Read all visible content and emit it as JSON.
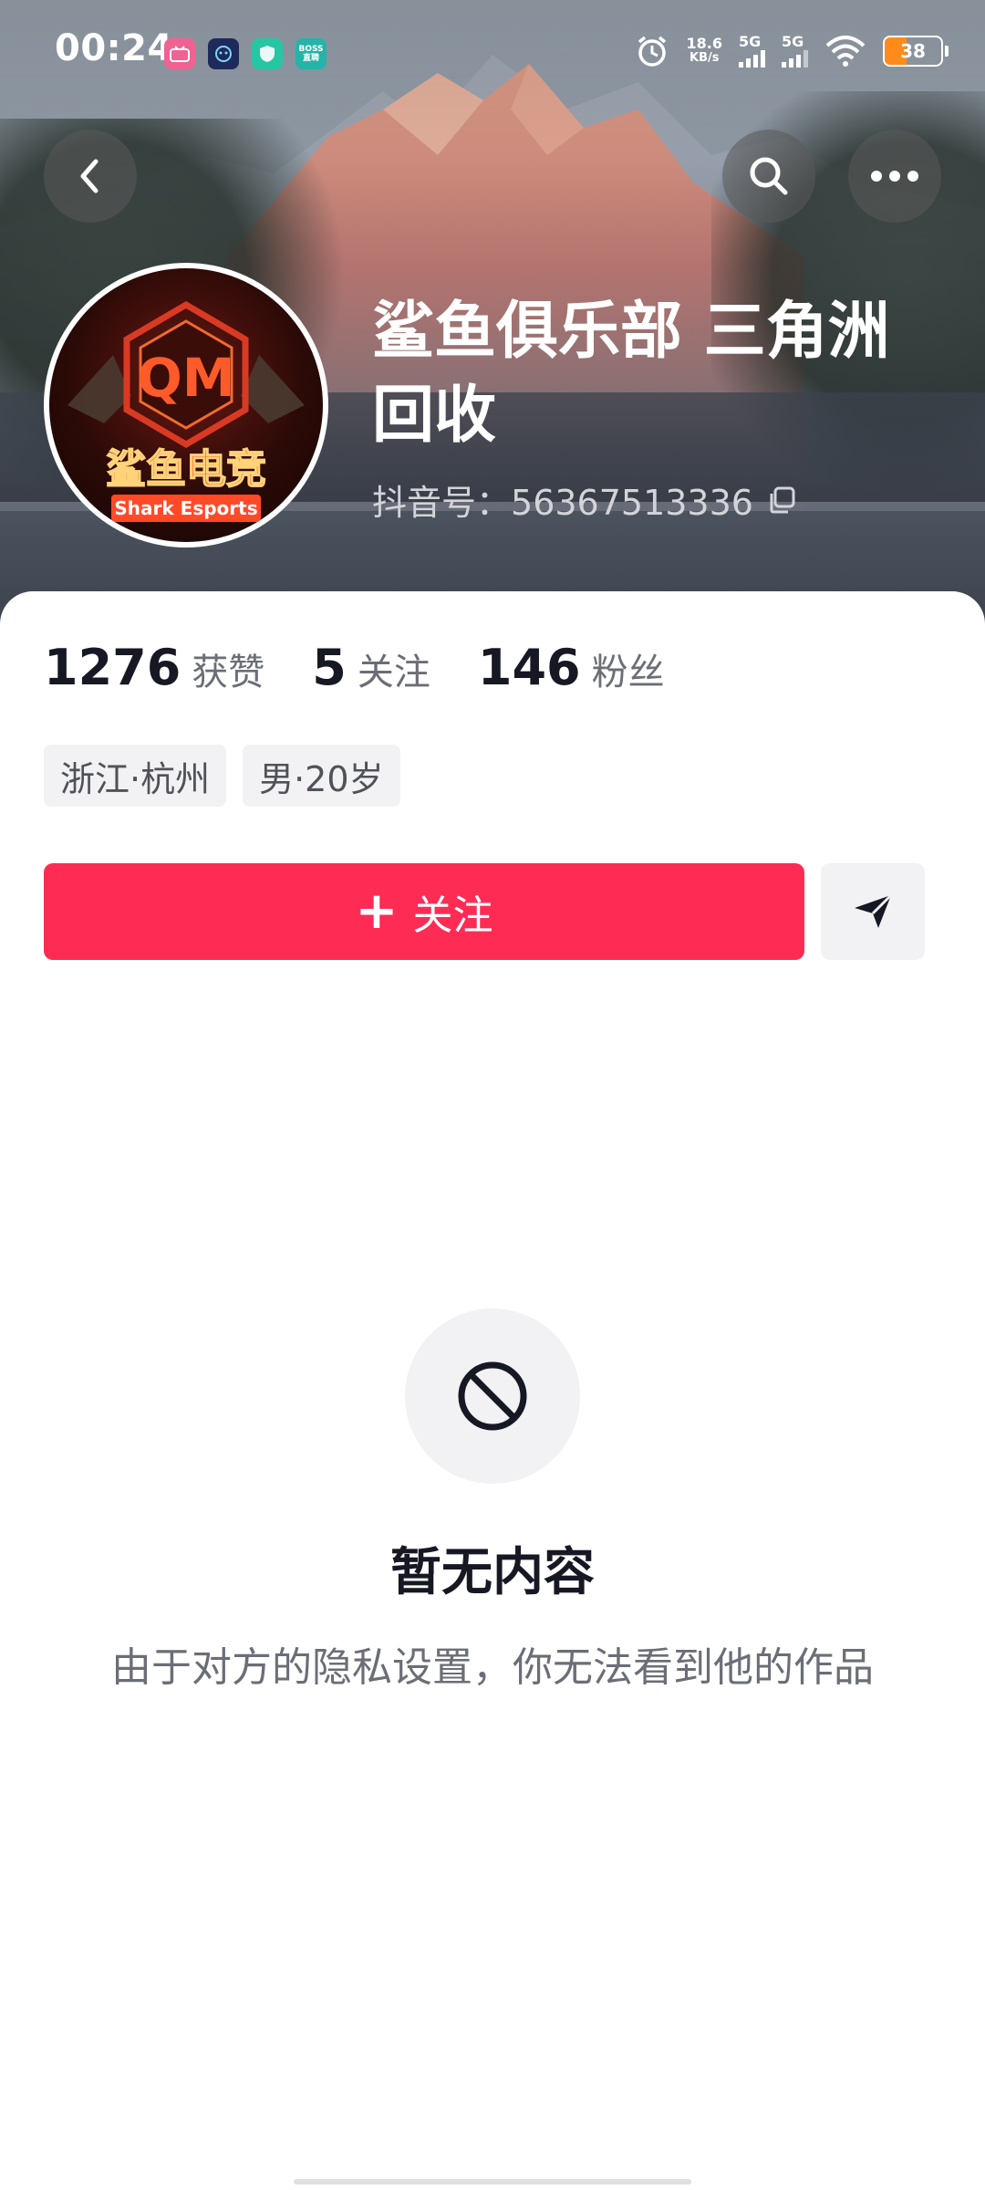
{
  "status_bar": {
    "time": "00:24",
    "apps": [
      {
        "icon": "bilibili-icon",
        "color": "#f06292"
      },
      {
        "icon": "robot-app-icon",
        "color": "#1e2a5a"
      },
      {
        "icon": "shield-app-icon",
        "color": "#26c6a4"
      },
      {
        "icon": "boss-zhipin-icon",
        "color": "#26b3a8",
        "label": "BOSS 直聘"
      }
    ],
    "net_speed": "18.6",
    "net_unit": "KB/s",
    "signal1": "5G",
    "signal2": "5G",
    "battery": "38",
    "battery_level": 0.38
  },
  "profile": {
    "name": "鲨鱼俱乐部 三角洲回收",
    "douyin_id_label": "抖音号：",
    "douyin_id": "56367513336",
    "avatar_title": "鲨鱼电竞",
    "avatar_subtitle": "Shark Esports",
    "avatar_monogram": "QM"
  },
  "stats": [
    {
      "num": "1276",
      "label": "获赞"
    },
    {
      "num": "5",
      "label": "关注"
    },
    {
      "num": "146",
      "label": "粉丝"
    }
  ],
  "tags": [
    "浙江·杭州",
    "男·20岁"
  ],
  "actions": {
    "follow_label": "关注",
    "follow_plus": "+"
  },
  "empty": {
    "title": "暂无内容",
    "description": "由于对方的隐私设置，你无法看到他的作品"
  },
  "colors": {
    "accent": "#fe2c55",
    "text_primary": "#161823",
    "text_secondary": "#6b6e76"
  }
}
